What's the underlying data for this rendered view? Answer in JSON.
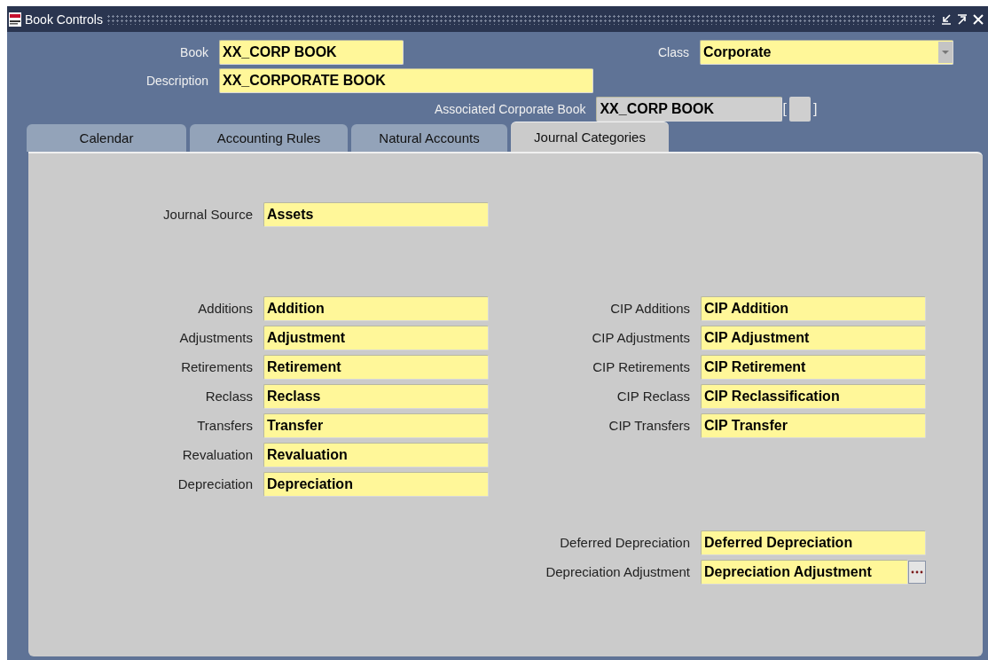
{
  "window": {
    "title": "Book Controls"
  },
  "header": {
    "book": {
      "label": "Book",
      "value": "XX_CORP BOOK"
    },
    "class": {
      "label": "Class",
      "value": "Corporate"
    },
    "description": {
      "label": "Description",
      "value": "XX_CORPORATE BOOK"
    },
    "associated": {
      "label": "Associated Corporate Book",
      "value": "XX_CORP BOOK"
    },
    "bracket_open": "[",
    "bracket_close": "]"
  },
  "tabs": [
    {
      "label": "Calendar",
      "selected": false
    },
    {
      "label": "Accounting Rules",
      "selected": false
    },
    {
      "label": "Natural Accounts",
      "selected": false
    },
    {
      "label": "Journal Categories",
      "selected": true
    }
  ],
  "journal_source": {
    "label": "Journal Source",
    "value": "Assets"
  },
  "left_fields": [
    {
      "label": "Additions",
      "value": "Addition"
    },
    {
      "label": "Adjustments",
      "value": "Adjustment"
    },
    {
      "label": "Retirements",
      "value": "Retirement"
    },
    {
      "label": "Reclass",
      "value": "Reclass"
    },
    {
      "label": "Transfers",
      "value": "Transfer"
    },
    {
      "label": "Revaluation",
      "value": "Revaluation"
    },
    {
      "label": "Depreciation",
      "value": "Depreciation"
    }
  ],
  "right_fields": [
    {
      "label": "CIP Additions",
      "value": "CIP Addition"
    },
    {
      "label": "CIP Adjustments",
      "value": "CIP Adjustment"
    },
    {
      "label": "CIP Retirements",
      "value": "CIP Retirement"
    },
    {
      "label": "CIP Reclass",
      "value": "CIP Reclassification"
    },
    {
      "label": "CIP Transfers",
      "value": "CIP Transfer"
    }
  ],
  "deferred_fields": [
    {
      "label": "Deferred Depreciation",
      "value": "Deferred Depreciation",
      "kind": "plain"
    },
    {
      "label": "Depreciation Adjustment",
      "value": "Depreciation Adjustment",
      "kind": "lov"
    }
  ]
}
